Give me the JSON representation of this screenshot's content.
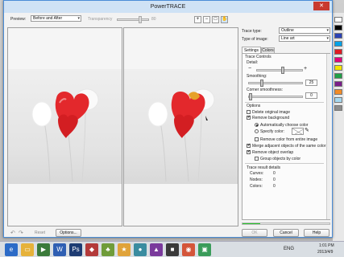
{
  "dialog": {
    "title": "PowerTRACE",
    "close_glyph": "✕"
  },
  "top": {
    "preview_label": "Preview:",
    "preview_value": "Before and After",
    "transparency_label": "Transparency",
    "transparency_value": "80"
  },
  "tools": [
    "zoom-in-icon",
    "zoom-out-icon",
    "fit-icon",
    "pan-icon"
  ],
  "right": {
    "trace_type_label": "Trace type:",
    "trace_type_value": "Outline",
    "type_of_image_label": "Type of image:",
    "type_of_image_value": "Line art",
    "tabs": [
      "Settings",
      "Colors"
    ],
    "trace_controls_label": "Trace Controls",
    "detail_label": "Detail:",
    "detail_level": 0.55,
    "smoothing_label": "Smoothing:",
    "smoothing_value": "25",
    "corner_label": "Corner smoothness:",
    "corner_value": "0",
    "options_label": "Options",
    "delete_original": "Delete original image",
    "remove_background": "Remove background",
    "auto_choose": "Automatically choose color",
    "specify_color": "Specify color:",
    "remove_entire": "Remove color from entire image",
    "merge_adjacent": "Merge adjacent objects of the same color",
    "remove_overlap": "Remove object overlap",
    "group_by_color": "Group objects by color",
    "details_label": "Trace result details",
    "curves_label": "Curves:",
    "curves_value": "0",
    "nodes_label": "Nodes:",
    "nodes_value": "0",
    "colors_label": "Colors:",
    "colors_value": "0",
    "progress": 0.2
  },
  "bottom": {
    "reset": "Reset",
    "options": "Options...",
    "ok": "OK",
    "cancel": "Cancel",
    "help": "Help"
  },
  "tray": {
    "lang": "ENG",
    "time": "1:01 PM",
    "date": "2013/4/9"
  },
  "colors": {
    "accent": "#2c6bc7",
    "balloon_red": "#e3282c",
    "progress": "#27c22b"
  }
}
